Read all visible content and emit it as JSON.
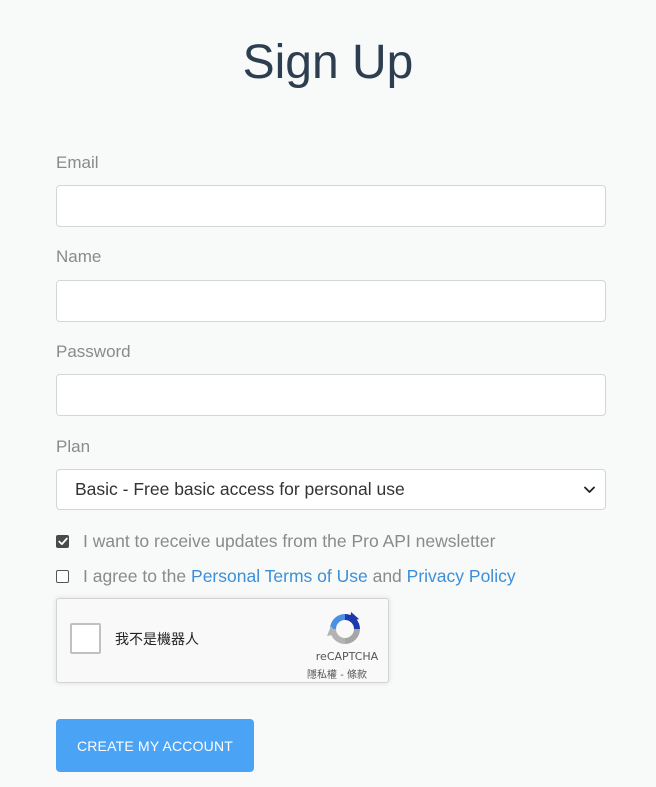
{
  "page": {
    "title": "Sign Up"
  },
  "form": {
    "email": {
      "label": "Email",
      "value": "",
      "placeholder": ""
    },
    "name": {
      "label": "Name",
      "value": "",
      "placeholder": ""
    },
    "password": {
      "label": "Password",
      "value": "",
      "placeholder": ""
    },
    "plan": {
      "label": "Plan",
      "selected": "Basic - Free basic access for personal use"
    },
    "newsletter": {
      "checked": true,
      "label": "I want to receive updates from the Pro API newsletter"
    },
    "terms": {
      "checked": false,
      "prefix": "I agree to the",
      "terms_link": "Personal Terms of Use",
      "joiner": "and",
      "privacy_link": "Privacy Policy"
    },
    "submit_label": "CREATE MY ACCOUNT"
  },
  "recaptcha": {
    "label": "我不是機器人",
    "brand": "reCAPTCHA",
    "privacy": "隱私權",
    "separator": " - ",
    "terms": "條款"
  },
  "colors": {
    "accent": "#4aa3f5",
    "link": "#3d8fd8",
    "title": "#2c3e50"
  }
}
